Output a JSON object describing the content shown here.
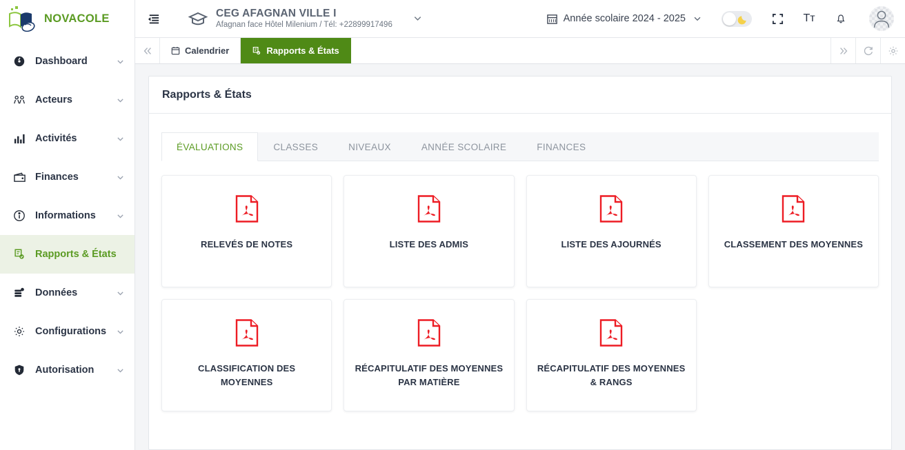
{
  "brand": {
    "name": "NOVACOLE",
    "logo_icon": "book-mouse-logo"
  },
  "sidebar": {
    "items": [
      {
        "label": "Dashboard",
        "icon": "speedometer-icon",
        "has_caret": true,
        "active": false
      },
      {
        "label": "Acteurs",
        "icon": "users-icon",
        "has_caret": true,
        "active": false
      },
      {
        "label": "Activités",
        "icon": "bar-chart-icon",
        "has_caret": true,
        "active": false
      },
      {
        "label": "Finances",
        "icon": "wallet-icon",
        "has_caret": true,
        "active": false
      },
      {
        "label": "Informations",
        "icon": "info-circle-icon",
        "has_caret": true,
        "active": false
      },
      {
        "label": "Rapports & États",
        "icon": "report-check-icon",
        "has_caret": false,
        "active": true
      },
      {
        "label": "Données",
        "icon": "database-icon",
        "has_caret": true,
        "active": false
      },
      {
        "label": "Configurations",
        "icon": "gear-icon",
        "has_caret": true,
        "active": false
      },
      {
        "label": "Autorisation",
        "icon": "shield-icon",
        "has_caret": true,
        "active": false
      }
    ]
  },
  "topbar": {
    "collapse_icon": "menu-collapse-icon",
    "school_icon": "graduation-cap-icon",
    "school_name": "CEG AFAGNAN VILLE I",
    "school_subtitle": "Afagnan face Hôtel Milenium / Tél: +22899917496",
    "school_caret_icon": "chevron-down-icon",
    "year_icon": "calendar-icon",
    "year_label": "Année scolaire 2024 - 2025",
    "year_caret_icon": "chevron-down-icon",
    "theme_toggle_icon": "moon-icon",
    "theme_toggle_on": false,
    "fullscreen_icon": "fullscreen-icon",
    "text_size_label": "Tт",
    "text_size_icon": "text-size-icon",
    "bell_icon": "bell-icon",
    "avatar_icon": "user-avatar-icon"
  },
  "window_tabs": {
    "back_icon": "chevron-double-left-icon",
    "items": [
      {
        "label": "Calendrier",
        "icon": "calendar-icon",
        "active": false
      },
      {
        "label": "Rapports & États",
        "icon": "report-check-icon",
        "active": true
      }
    ],
    "right_actions": [
      {
        "name": "forward",
        "icon": "chevron-double-right-icon"
      },
      {
        "name": "reload",
        "icon": "refresh-icon"
      },
      {
        "name": "settings",
        "icon": "gear-icon"
      }
    ]
  },
  "page": {
    "title": "Rapports & États",
    "tabs": [
      {
        "label": "ÉVALUATIONS",
        "active": true
      },
      {
        "label": "CLASSES",
        "active": false
      },
      {
        "label": "NIVEAUX",
        "active": false
      },
      {
        "label": "ANNÉE SCOLAIRE",
        "active": false
      },
      {
        "label": "FINANCES",
        "active": false
      }
    ],
    "cards": [
      {
        "label": "RELEVÉS DE NOTES",
        "icon": "pdf-icon"
      },
      {
        "label": "LISTE DES ADMIS",
        "icon": "pdf-icon"
      },
      {
        "label": "LISTE DES AJOURNÉS",
        "icon": "pdf-icon"
      },
      {
        "label": "CLASSEMENT DES MOYENNES",
        "icon": "pdf-icon"
      },
      {
        "label": "CLASSIFICATION DES MOYENNES",
        "icon": "pdf-icon"
      },
      {
        "label": "RÉCAPITULATIF DES MOYENNES PAR MATIÈRE",
        "icon": "pdf-icon"
      },
      {
        "label": "RÉCAPITULATIF DES MOYENNES & RANGS",
        "icon": "pdf-icon"
      }
    ]
  },
  "colors": {
    "brand_green": "#5b9b23",
    "tab_active_green": "#4f8a16",
    "sidebar_active_bg": "#ecf2e5",
    "pdf_red": "#ed1c24",
    "page_bg": "#f4f5f7",
    "text_dark": "#2b3445"
  }
}
